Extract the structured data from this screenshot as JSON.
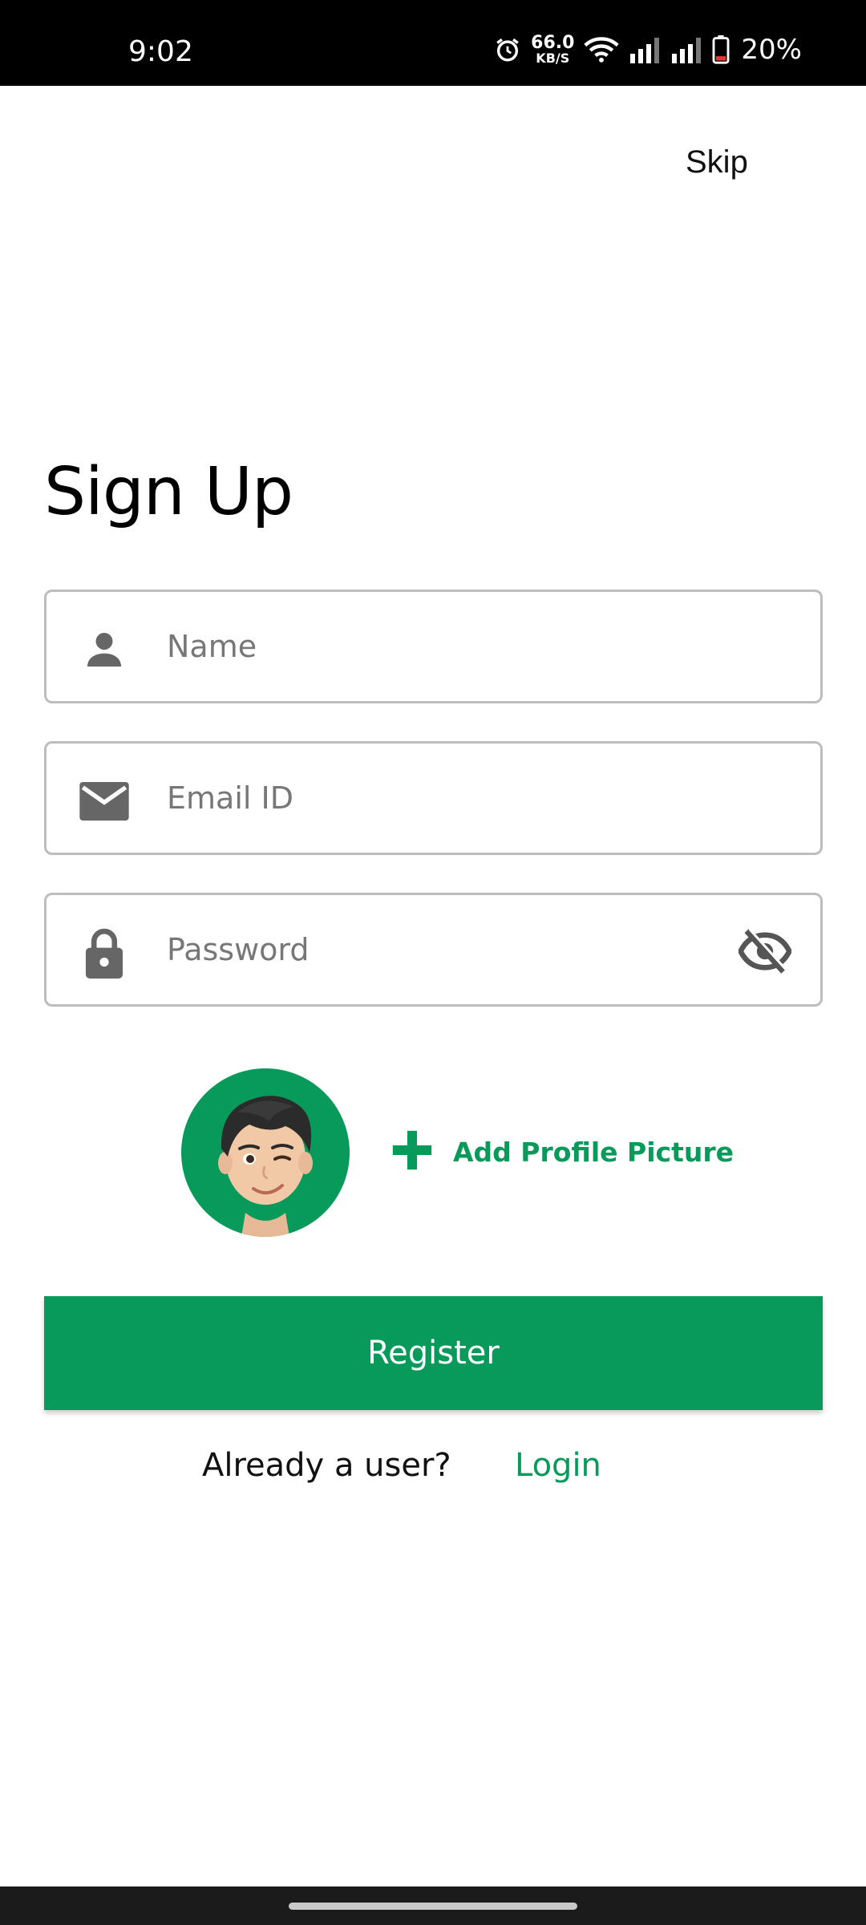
{
  "status_bar": {
    "time": "9:02",
    "net_speed_value": "66.0",
    "net_speed_unit": "KB/S",
    "battery_percent": "20%",
    "icons": [
      "alarm-icon",
      "wifi-icon",
      "signal-icon",
      "signal-icon",
      "battery-icon"
    ]
  },
  "header": {
    "skip_label": "Skip"
  },
  "page": {
    "title": "Sign Up"
  },
  "form": {
    "name": {
      "placeholder": "Name",
      "value": "",
      "icon": "person-icon"
    },
    "email": {
      "placeholder": "Email ID",
      "value": "",
      "icon": "mail-icon"
    },
    "password": {
      "placeholder": "Password",
      "value": "",
      "icon": "lock-icon",
      "toggle_icon": "eye-off-icon"
    }
  },
  "profile": {
    "add_label": "Add Profile Picture",
    "avatar_icon": "memoji-avatar"
  },
  "actions": {
    "register_label": "Register",
    "already_user_text": "Already a user?",
    "login_label": "Login"
  },
  "colors": {
    "accent": "#079a5a",
    "border": "#bdbdbd",
    "icon_gray": "#666666"
  }
}
